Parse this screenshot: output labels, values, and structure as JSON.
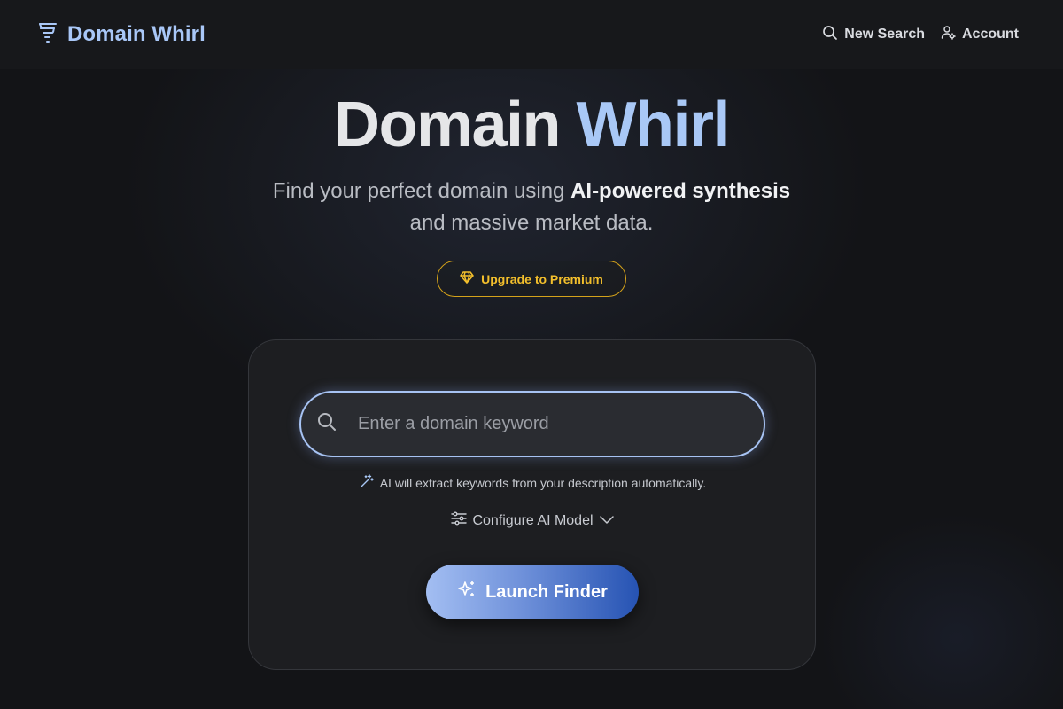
{
  "header": {
    "brand_name": "Domain Whirl",
    "brand_icon": "tornado-icon",
    "nav": [
      {
        "label": "New Search",
        "icon": "search-icon"
      },
      {
        "label": "Account",
        "icon": "user-gear-icon"
      }
    ]
  },
  "hero": {
    "title_main": "Domain",
    "title_accent": "Whirl",
    "subtitle_1": "Find your perfect domain using ",
    "subtitle_bold_1": "AI-powered synthesis",
    "subtitle_2": " and massive market data."
  },
  "premium": {
    "label": "Upgrade to Premium",
    "icon": "diamond-icon"
  },
  "search": {
    "placeholder": "Enter a domain keyword",
    "value": "",
    "hint": "AI will extract keywords from your description automatically.",
    "hint_icon": "magic-wand-icon"
  },
  "config": {
    "label": "Configure AI Model",
    "icon": "sliders-icon",
    "chevron": "chevron-down-icon"
  },
  "launch": {
    "label": "Launch Finder",
    "icon": "sparkles-icon"
  },
  "colors": {
    "background": "#131417",
    "header_bg": "#17181b",
    "accent_blue": "#a9c8f6",
    "premium_gold": "#f3bf2c",
    "card_bg": "#1d1e21",
    "button_gradient_start": "#a3bef2",
    "button_gradient_end": "#2653b3"
  }
}
